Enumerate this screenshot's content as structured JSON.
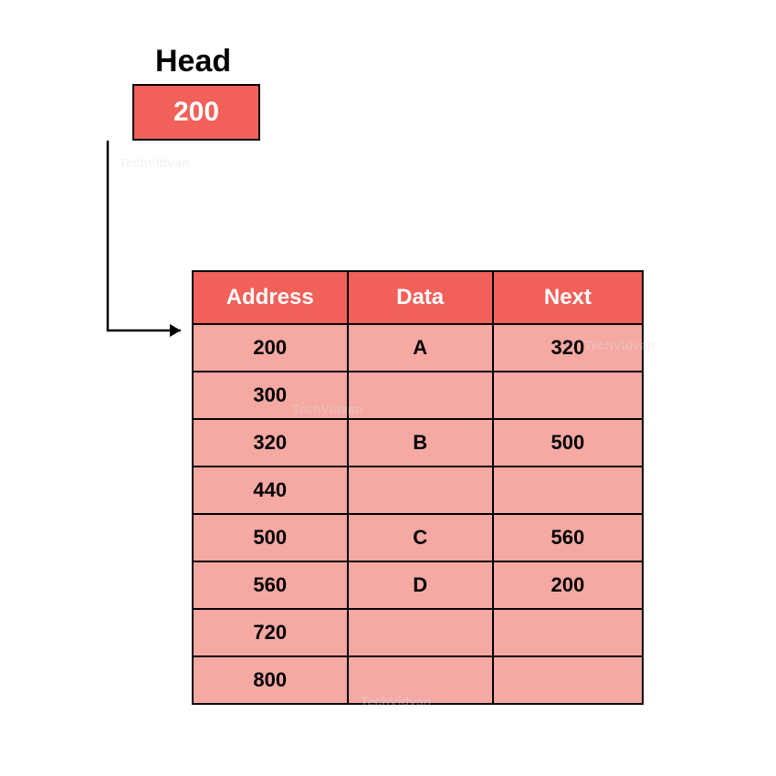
{
  "head": {
    "label": "Head",
    "value": "200"
  },
  "table": {
    "headers": {
      "address": "Address",
      "data": "Data",
      "next": "Next"
    },
    "rows": [
      {
        "address": "200",
        "data": "A",
        "next": "320"
      },
      {
        "address": "300",
        "data": "",
        "next": ""
      },
      {
        "address": "320",
        "data": "B",
        "next": "500"
      },
      {
        "address": "440",
        "data": "",
        "next": ""
      },
      {
        "address": "500",
        "data": "C",
        "next": "560"
      },
      {
        "address": "560",
        "data": "D",
        "next": "200"
      },
      {
        "address": "720",
        "data": "",
        "next": ""
      },
      {
        "address": "800",
        "data": "",
        "next": ""
      }
    ]
  },
  "watermark": "TechVidvan"
}
